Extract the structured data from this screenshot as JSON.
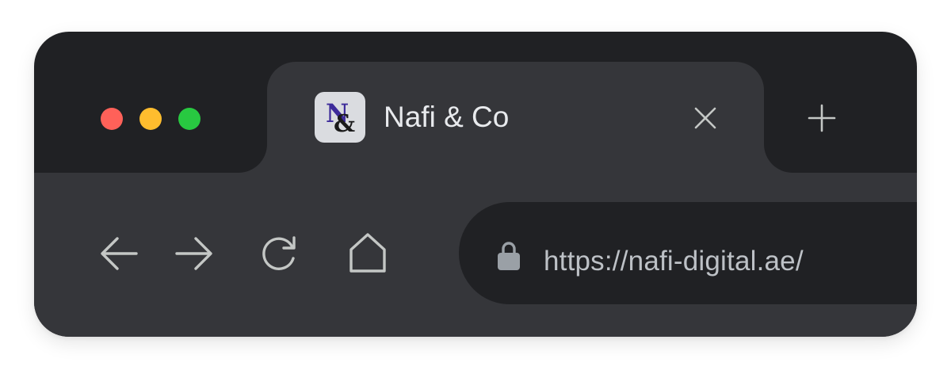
{
  "window": {
    "controls": [
      {
        "name": "close",
        "color": "#ff6159"
      },
      {
        "name": "minimize",
        "color": "#ffbd2e"
      },
      {
        "name": "maximize",
        "color": "#28c941"
      }
    ]
  },
  "tab": {
    "title": "Nafi & Co",
    "favicon_icon": "nafi-co-monogram-icon",
    "close_icon": "close-icon"
  },
  "new_tab": {
    "icon": "plus-icon"
  },
  "nav": {
    "back_icon": "arrow-left-icon",
    "forward_icon": "arrow-right-icon",
    "reload_icon": "reload-icon",
    "home_icon": "home-icon"
  },
  "address_bar": {
    "lock_icon": "lock-icon",
    "url": "https://nafi-digital.ae/"
  },
  "colors": {
    "titlebar": "#202124",
    "toolbar": "#35363a",
    "text": "#e8eaed",
    "url_text": "#bdc1c6",
    "icon": "#c4c7c5"
  }
}
